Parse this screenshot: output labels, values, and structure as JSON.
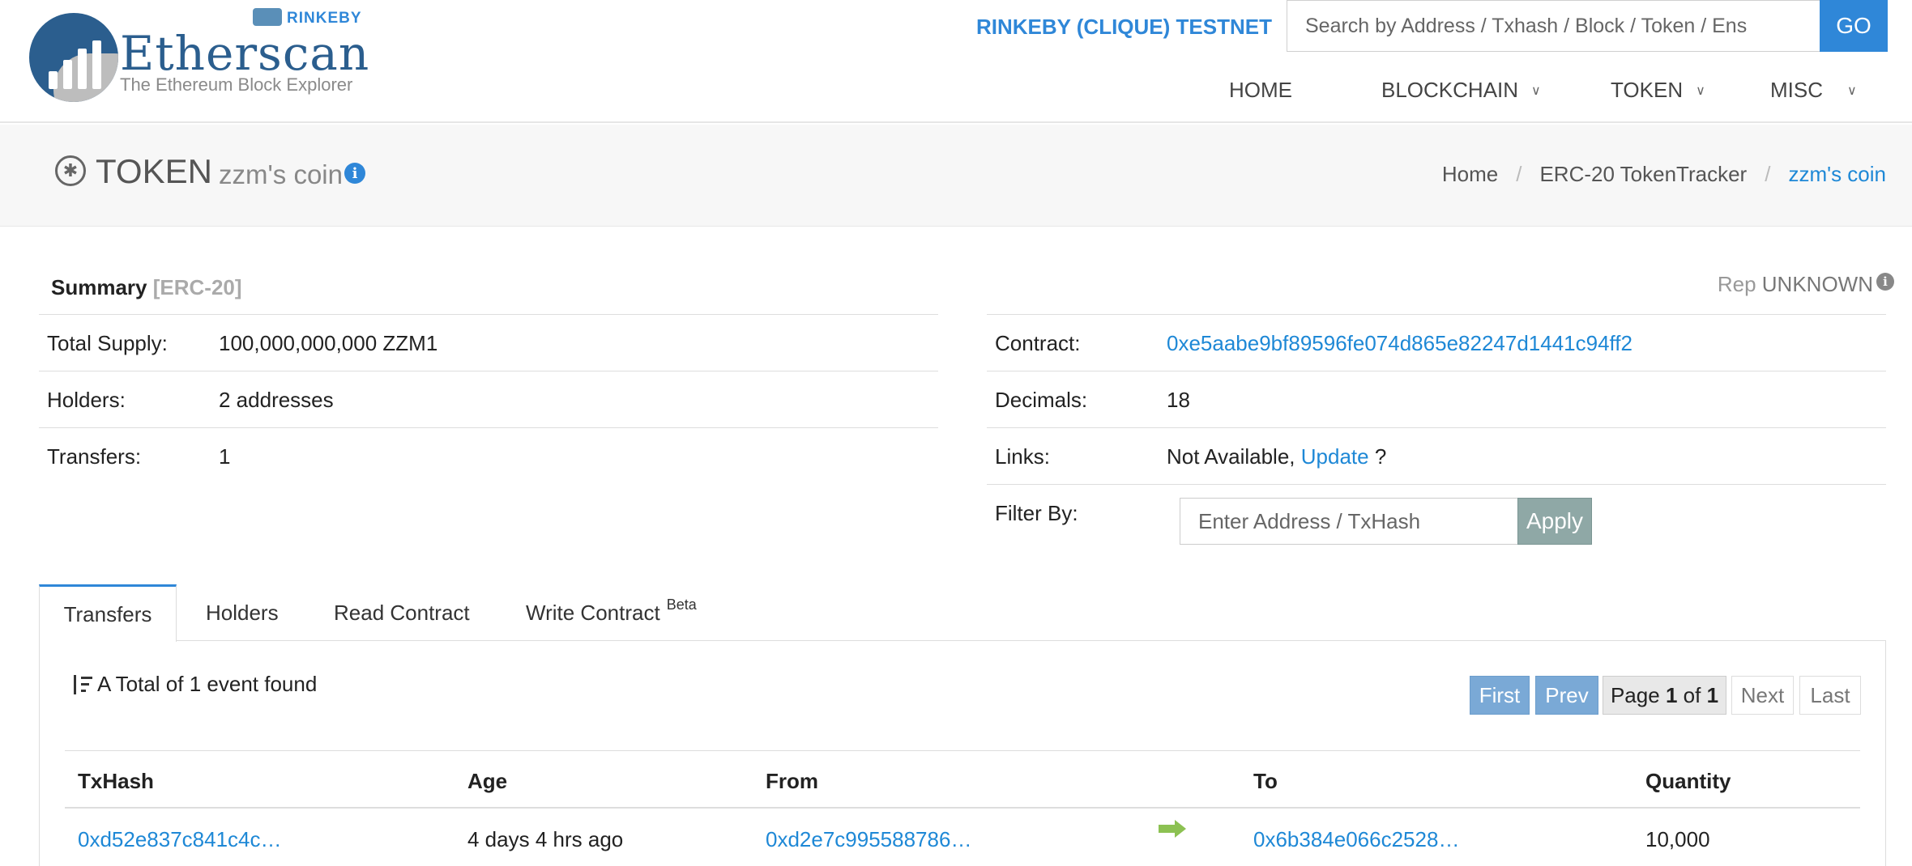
{
  "brand": {
    "name": "Etherscan",
    "tagline": "The Ethereum Block Explorer",
    "network_badge": "RINKEBY"
  },
  "header": {
    "network": "RINKEBY (CLIQUE) TESTNET",
    "search_placeholder": "Search by Address / Txhash / Block / Token / Ens",
    "go_label": "GO",
    "nav": [
      {
        "label": "HOME"
      },
      {
        "label": "BLOCKCHAIN"
      },
      {
        "label": "TOKEN"
      },
      {
        "label": "MISC"
      }
    ]
  },
  "page": {
    "title": "TOKEN",
    "token_name": "zzm's coin",
    "breadcrumb": [
      "Home",
      "ERC-20 TokenTracker",
      "zzm's coin"
    ]
  },
  "summary": {
    "heading": "Summary",
    "tag": "[ERC-20]",
    "rep_label": "Rep",
    "rep_value": "UNKNOWN",
    "left": [
      {
        "key": "Total Supply:",
        "value": "100,000,000,000 ZZM1"
      },
      {
        "key": "Holders:",
        "value": "2 addresses"
      },
      {
        "key": "Transfers:",
        "value": "1"
      }
    ],
    "contract_key": "Contract:",
    "contract_value": "0xe5aabe9bf89596fe074d865e82247d1441c94ff2",
    "decimals_key": "Decimals:",
    "decimals_value": "18",
    "links_key": "Links:",
    "links_text": "Not Available,",
    "links_update": "Update",
    "links_q": "?",
    "filter_key": "Filter By:",
    "filter_placeholder": "Enter Address / TxHash",
    "apply_label": "Apply"
  },
  "tabs": [
    {
      "label": "Transfers"
    },
    {
      "label": "Holders"
    },
    {
      "label": "Read Contract"
    },
    {
      "label": "Write Contract",
      "badge": "Beta"
    }
  ],
  "transfers": {
    "count_text": "A Total of 1 event found",
    "pagination": {
      "first": "First",
      "prev": "Prev",
      "page_prefix": "Page",
      "page": "1",
      "of": "of",
      "total": "1",
      "next": "Next",
      "last": "Last"
    },
    "columns": [
      "TxHash",
      "Age",
      "From",
      "To",
      "Quantity"
    ],
    "rows": [
      {
        "txhash": "0xd52e837c841c4c…",
        "age": "4 days 4 hrs ago",
        "from": "0xd2e7c995588786…",
        "to": "0x6b384e066c2528…",
        "quantity": "10,000"
      }
    ]
  },
  "colors": {
    "accent": "#2f87d8",
    "brand": "#2b5e8e",
    "arrow": "#8cc152"
  }
}
